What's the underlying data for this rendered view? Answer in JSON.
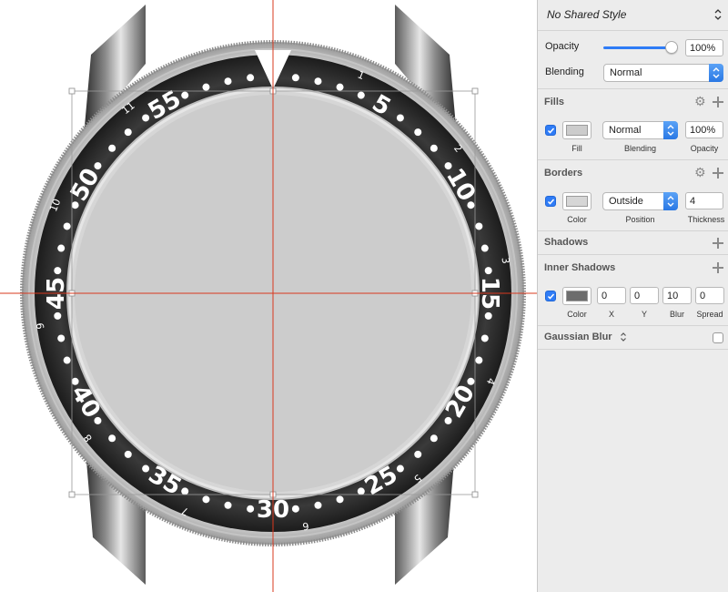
{
  "canvas": {
    "bezel": {
      "numerals": [
        "5",
        "10",
        "15",
        "20",
        "25",
        "30",
        "35",
        "40",
        "45",
        "50",
        "55"
      ],
      "hour_marks": [
        "1",
        "2",
        "3",
        "4",
        "5",
        "6",
        "7",
        "8",
        "9",
        "10",
        "11"
      ]
    }
  },
  "inspector": {
    "shared_style": "No Shared Style",
    "opacity": {
      "label": "Opacity",
      "value": "100%",
      "level": 1.0
    },
    "blending": {
      "label": "Blending",
      "value": "Normal"
    },
    "fills": {
      "title": "Fills",
      "enabled": true,
      "swatch_color": "#cccccc",
      "blending": "Normal",
      "opacity": "100%",
      "captions": {
        "fill": "Fill",
        "blending": "Blending",
        "opacity": "Opacity"
      }
    },
    "borders": {
      "title": "Borders",
      "enabled": true,
      "swatch_color": "#d6d6d6",
      "position": "Outside",
      "thickness": "4",
      "captions": {
        "color": "Color",
        "position": "Position",
        "thickness": "Thickness"
      }
    },
    "shadows": {
      "title": "Shadows"
    },
    "inner_shadows": {
      "title": "Inner Shadows",
      "enabled": true,
      "swatch_color": "#6d6d6d",
      "x": "0",
      "y": "0",
      "blur": "10",
      "spread": "0",
      "captions": {
        "color": "Color",
        "x": "X",
        "y": "Y",
        "blur": "Blur",
        "spread": "Spread"
      }
    },
    "gaussian_blur": {
      "title": "Gaussian Blur",
      "enabled": false
    }
  },
  "colors": {
    "accent": "#2f7cf6",
    "guide": "#d9381e",
    "bezel": "#222222",
    "dial": "#cccccc"
  }
}
